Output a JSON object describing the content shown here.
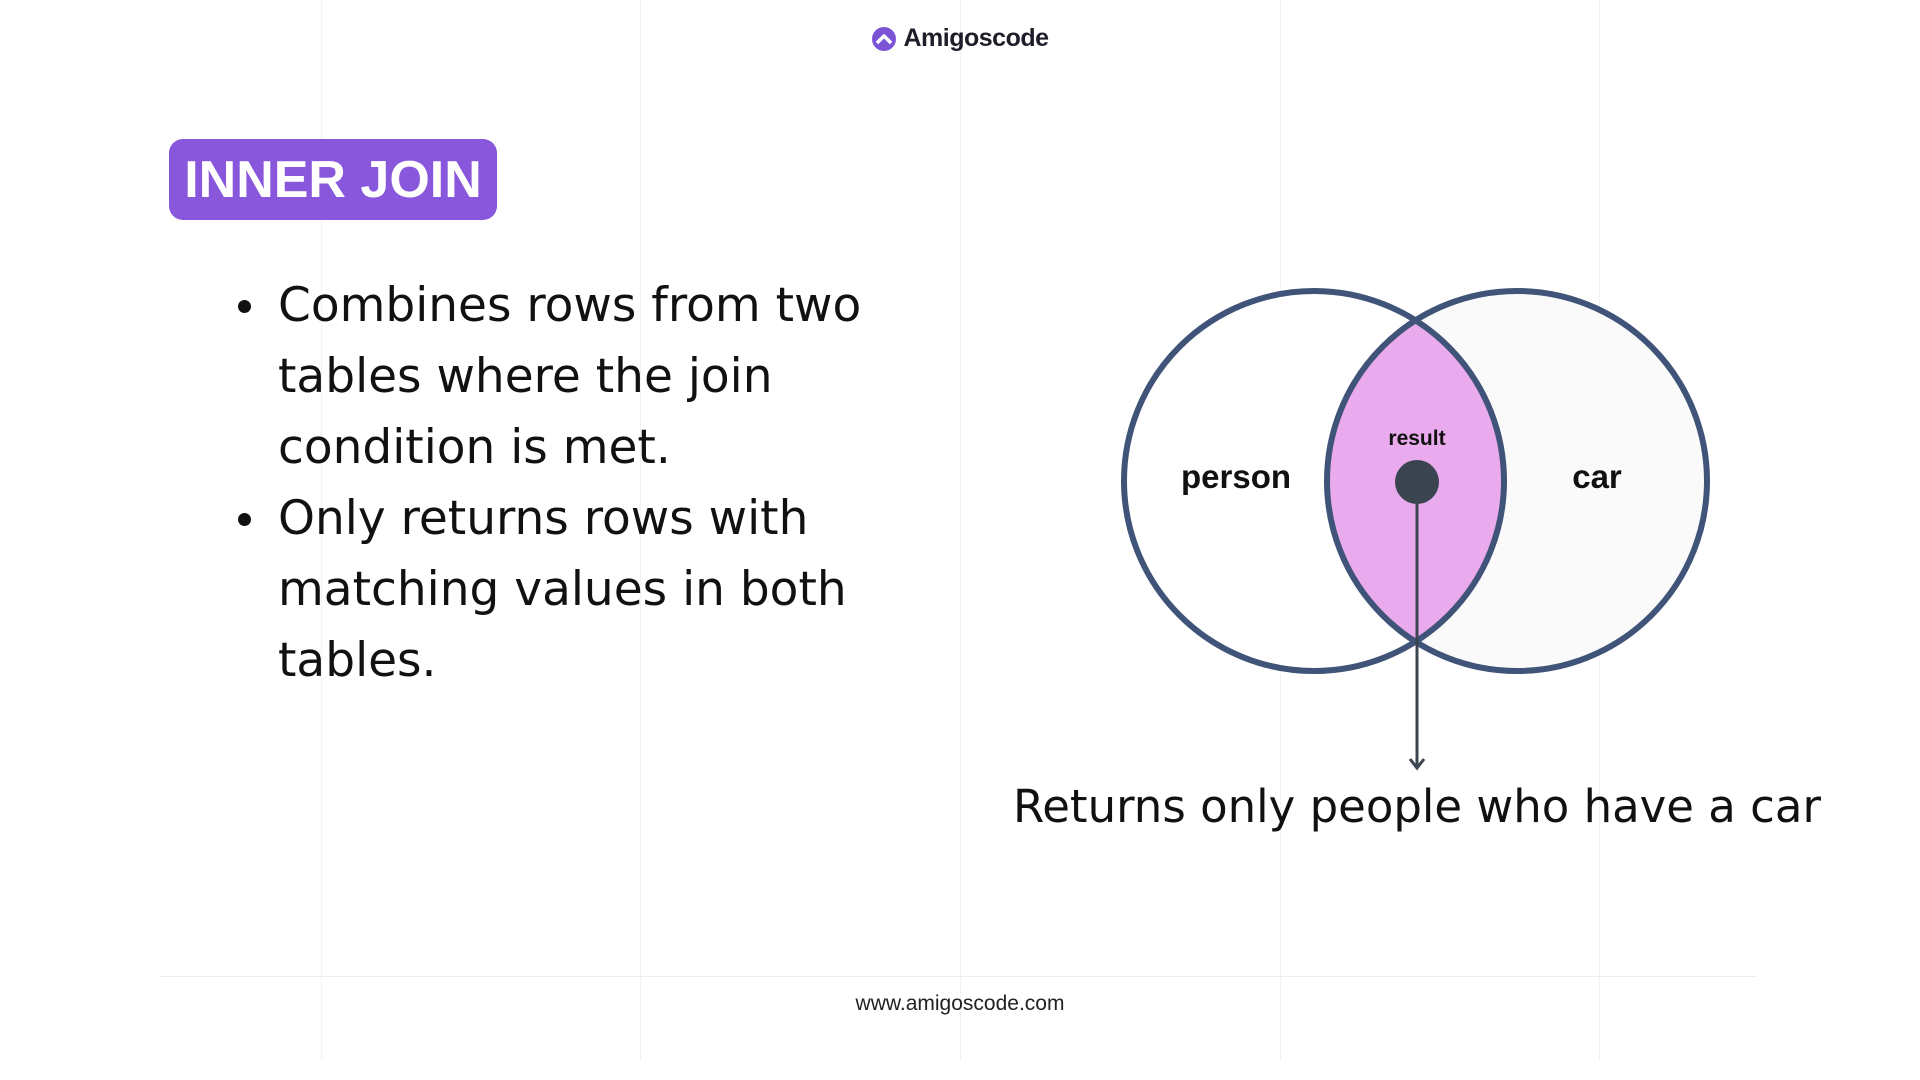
{
  "header": {
    "logo_text": "Amigoscode",
    "logo_icon": "chevron-up-circle-icon"
  },
  "badge": {
    "label": "INNER JOIN"
  },
  "bullets": [
    {
      "lines": [
        "Combines rows from two",
        "tables where the join",
        "condition is met."
      ]
    },
    {
      "lines": [
        "Only returns rows with",
        "matching values in both",
        "tables."
      ]
    }
  ],
  "diagram": {
    "left_label": "person",
    "right_label": "car",
    "intersection_label": "result",
    "caption": "Returns only people who have a car",
    "colors": {
      "stroke": "#3f5478",
      "intersection": "#e9aaee",
      "dot": "#3a454f",
      "right_fill": "#fafafa"
    }
  },
  "footer": {
    "url": "www.amigoscode.com"
  },
  "colors": {
    "accent": "#8857dc"
  }
}
